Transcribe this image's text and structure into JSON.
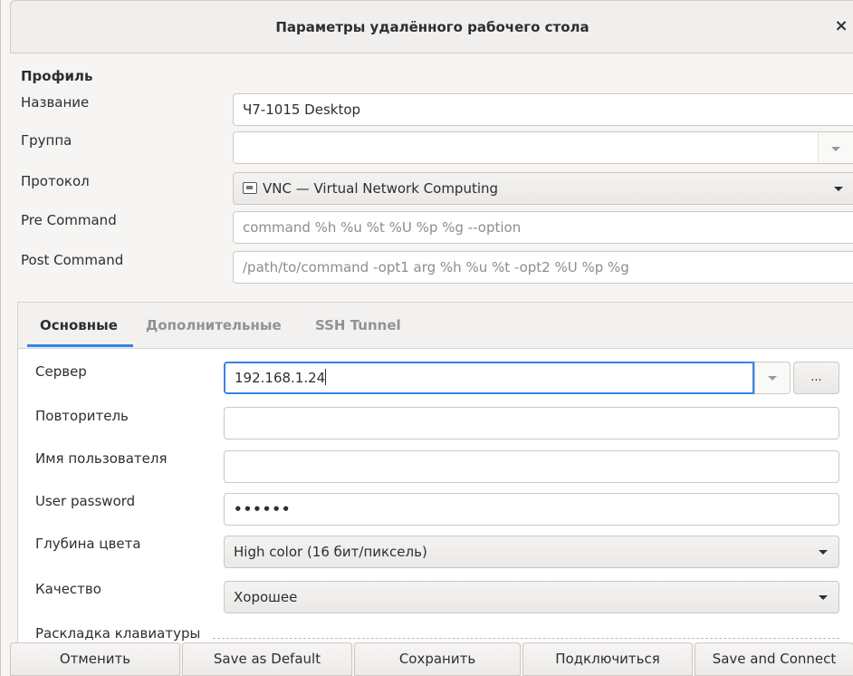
{
  "window": {
    "title": "Параметры удалённого рабочего стола",
    "close_glyph": "×"
  },
  "profile": {
    "section_title": "Профиль",
    "name_label": "Название",
    "name_value": "Ч7-1015 Desktop",
    "group_label": "Группа",
    "group_value": "",
    "protocol_label": "Протокол",
    "protocol_value": "VNC — Virtual Network Computing",
    "protocol_icon": "vnc-plugin-icon",
    "precommand_label": "Pre Command",
    "precommand_placeholder": "command %h %u %t %U %p %g --option",
    "postcommand_label": "Post Command",
    "postcommand_placeholder": "/path/to/command -opt1 arg %h %u %t -opt2 %U %p %g"
  },
  "tabs": [
    {
      "label": "Основные",
      "active": true
    },
    {
      "label": "Дополнительные",
      "active": false
    },
    {
      "label": "SSH Tunnel",
      "active": false
    }
  ],
  "basic": {
    "server_label": "Сервер",
    "server_value": "192.168.1.24",
    "server_browse_label": "...",
    "repeater_label": "Повторитель",
    "repeater_value": "",
    "username_label": "Имя пользователя",
    "username_value": "",
    "password_label": "User password",
    "password_value": "••••••",
    "color_depth_label": "Глубина цвета",
    "color_depth_value": "High color (16 бит/пиксель)",
    "quality_label": "Качество",
    "quality_value": "Хорошее",
    "keyboard_label": "Раскладка клавиатуры"
  },
  "footer": {
    "cancel": "Отменить",
    "save_default": "Save as Default",
    "save": "Сохранить",
    "connect": "Подключиться",
    "save_connect": "Save and Connect"
  },
  "colors": {
    "accent": "#3584e4",
    "window_bg": "#f6f5f4"
  }
}
